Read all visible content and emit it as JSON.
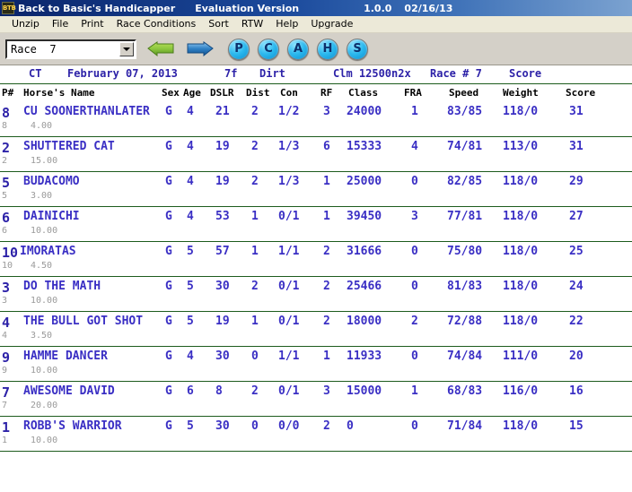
{
  "window": {
    "icon_text": "BTB",
    "title": "Back to Basic's Handicapper",
    "edition": "Evaluation Version",
    "version": "1.0.0",
    "date": "02/16/13"
  },
  "menubar": {
    "items": [
      {
        "label": "Unzip"
      },
      {
        "label": "File"
      },
      {
        "label": "Print"
      },
      {
        "label": "Race Conditions"
      },
      {
        "label": "Sort"
      },
      {
        "label": "RTW"
      },
      {
        "label": "Help"
      },
      {
        "label": "Upgrade"
      }
    ]
  },
  "toolbar": {
    "race_select_value": "Race  7",
    "prev_icon": "left-arrow-icon",
    "next_icon": "right-arrow-icon",
    "round_buttons": [
      {
        "label": "P",
        "name": "past-performance-button"
      },
      {
        "label": "C",
        "name": "class-button"
      },
      {
        "label": "A",
        "name": "analysis-button"
      },
      {
        "label": "H",
        "name": "horse-button"
      },
      {
        "label": "S",
        "name": "speed-button"
      }
    ],
    "accent_color": "#2bb8ee"
  },
  "race_info": {
    "track": "CT",
    "date": "February 07, 2013",
    "distance": "7f",
    "surface": "Dirt",
    "class": "Clm 12500n2x",
    "race_number": "Race # 7",
    "score_label": "Score",
    "text_color": "#2d22a8"
  },
  "columns": [
    {
      "key": "pnum",
      "label": "P#"
    },
    {
      "key": "name",
      "label": "Horse's Name"
    },
    {
      "key": "sex",
      "label": "Sex"
    },
    {
      "key": "age",
      "label": "Age"
    },
    {
      "key": "dslr",
      "label": "DSLR"
    },
    {
      "key": "dist",
      "label": "Dist"
    },
    {
      "key": "con",
      "label": "Con"
    },
    {
      "key": "rf",
      "label": "RF"
    },
    {
      "key": "class",
      "label": "Class"
    },
    {
      "key": "fra",
      "label": "FRA"
    },
    {
      "key": "speed",
      "label": "Speed"
    },
    {
      "key": "weight",
      "label": "Weight"
    },
    {
      "key": "score",
      "label": "Score"
    }
  ],
  "rows": [
    {
      "pnum": "8",
      "name": "CU SOONERTHANLATER",
      "sex": "G",
      "age": "4",
      "dslr": "21",
      "dist": "2",
      "con": "1/2",
      "rf": "3",
      "class": "24000",
      "fra": "1",
      "speed": "83/85",
      "weight": "118/0",
      "score": "31",
      "sub_pnum": "8",
      "odds": "4.00"
    },
    {
      "pnum": "2",
      "name": "SHUTTERED CAT",
      "sex": "G",
      "age": "4",
      "dslr": "19",
      "dist": "2",
      "con": "1/3",
      "rf": "6",
      "class": "15333",
      "fra": "4",
      "speed": "74/81",
      "weight": "113/0",
      "score": "31",
      "sub_pnum": "2",
      "odds": "15.00"
    },
    {
      "pnum": "5",
      "name": "BUDACOMO",
      "sex": "G",
      "age": "4",
      "dslr": "19",
      "dist": "2",
      "con": "1/3",
      "rf": "1",
      "class": "25000",
      "fra": "0",
      "speed": "82/85",
      "weight": "118/0",
      "score": "29",
      "sub_pnum": "5",
      "odds": "3.00"
    },
    {
      "pnum": "6",
      "name": "DAINICHI",
      "sex": "G",
      "age": "4",
      "dslr": "53",
      "dist": "1",
      "con": "0/1",
      "rf": "1",
      "class": "39450",
      "fra": "3",
      "speed": "77/81",
      "weight": "118/0",
      "score": "27",
      "sub_pnum": "6",
      "odds": "10.00"
    },
    {
      "pnum": "10",
      "name": "IMORATAS",
      "sex": "G",
      "age": "5",
      "dslr": "57",
      "dist": "1",
      "con": "1/1",
      "rf": "2",
      "class": "31666",
      "fra": "0",
      "speed": "75/80",
      "weight": "118/0",
      "score": "25",
      "sub_pnum": "10",
      "odds": "4.50"
    },
    {
      "pnum": "3",
      "name": "DO THE MATH",
      "sex": "G",
      "age": "5",
      "dslr": "30",
      "dist": "2",
      "con": "0/1",
      "rf": "2",
      "class": "25466",
      "fra": "0",
      "speed": "81/83",
      "weight": "118/0",
      "score": "24",
      "sub_pnum": "3",
      "odds": "10.00"
    },
    {
      "pnum": "4",
      "name": "THE BULL GOT SHOT",
      "sex": "G",
      "age": "5",
      "dslr": "19",
      "dist": "1",
      "con": "0/1",
      "rf": "2",
      "class": "18000",
      "fra": "2",
      "speed": "72/88",
      "weight": "118/0",
      "score": "22",
      "sub_pnum": "4",
      "odds": "3.50"
    },
    {
      "pnum": "9",
      "name": "HAMME DANCER",
      "sex": "G",
      "age": "4",
      "dslr": "30",
      "dist": "0",
      "con": "1/1",
      "rf": "1",
      "class": "11933",
      "fra": "0",
      "speed": "74/84",
      "weight": "111/0",
      "score": "20",
      "sub_pnum": "9",
      "odds": "10.00"
    },
    {
      "pnum": "7",
      "name": "AWESOME DAVID",
      "sex": "G",
      "age": "6",
      "dslr": "8",
      "dist": "2",
      "con": "0/1",
      "rf": "3",
      "class": "15000",
      "fra": "1",
      "speed": "68/83",
      "weight": "116/0",
      "score": "16",
      "sub_pnum": "7",
      "odds": "20.00"
    },
    {
      "pnum": "1",
      "name": "ROBB'S WARRIOR",
      "sex": "G",
      "age": "5",
      "dslr": "30",
      "dist": "0",
      "con": "0/0",
      "rf": "2",
      "class": "0",
      "fra": "0",
      "speed": "71/84",
      "weight": "118/0",
      "score": "15",
      "sub_pnum": "1",
      "odds": "10.00"
    }
  ]
}
